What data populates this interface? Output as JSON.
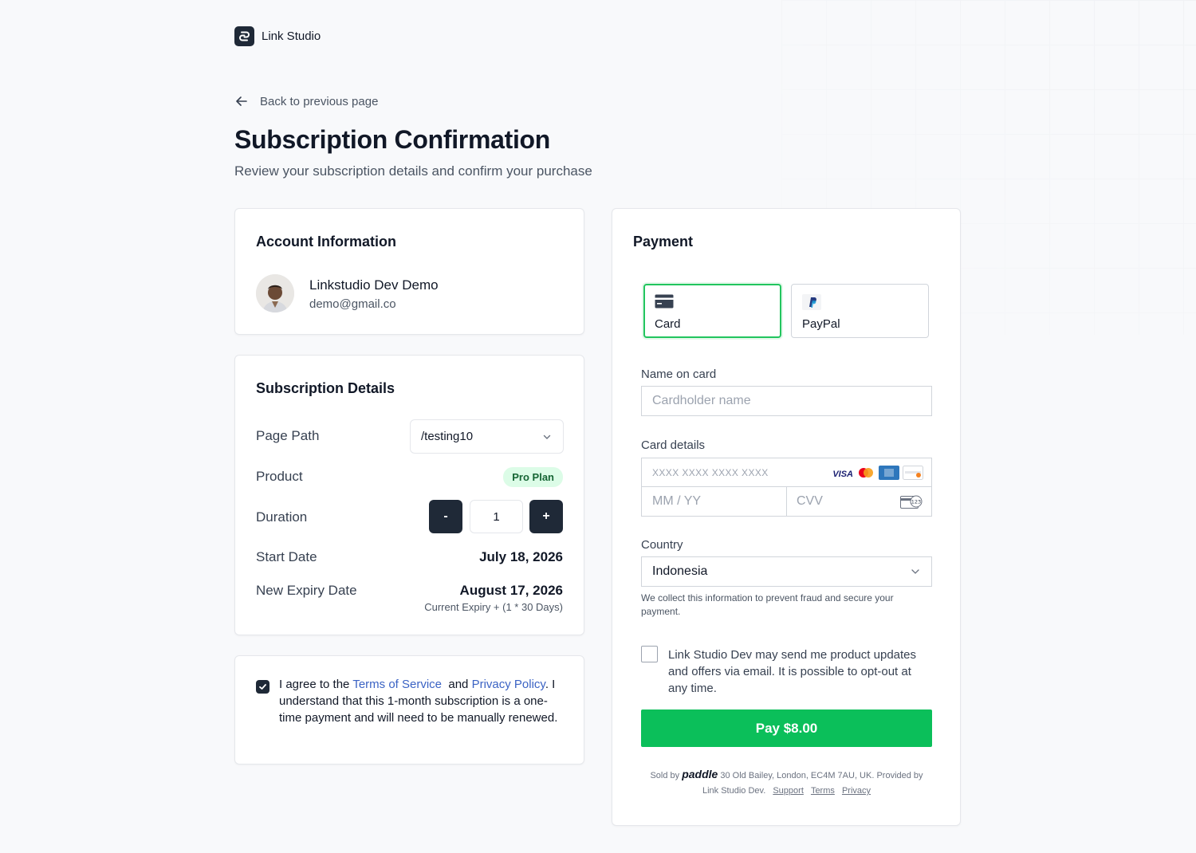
{
  "brand": {
    "name": "Link Studio"
  },
  "nav": {
    "back_label": "Back to previous page"
  },
  "page": {
    "title": "Subscription Confirmation",
    "subtitle": "Review your subscription details and confirm your purchase"
  },
  "account": {
    "title": "Account Information",
    "name": "Linkstudio Dev Demo",
    "email": "demo@gmail.co"
  },
  "subscription": {
    "title": "Subscription Details",
    "page_path_label": "Page Path",
    "page_path_value": "/testing10",
    "product_label": "Product",
    "product_badge": "Pro Plan",
    "duration_label": "Duration",
    "duration_minus": "-",
    "duration_value": "1",
    "duration_plus": "+",
    "start_date_label": "Start Date",
    "start_date_value": "July 18, 2026",
    "expiry_label": "New Expiry Date",
    "expiry_value": "August 17, 2026",
    "expiry_note": "Current Expiry + (1 * 30 Days)"
  },
  "agreement": {
    "prefix": "I agree to the",
    "terms_link": "Terms of Service",
    "and": "and",
    "privacy_link": "Privacy Policy",
    "suffix": ". I understand that this 1-month subscription is a one-time payment and will need to be manually renewed.",
    "checked": true
  },
  "payment": {
    "title": "Payment",
    "methods": [
      {
        "label": "Card",
        "icon": "credit-card-icon",
        "selected": true
      },
      {
        "label": "PayPal",
        "icon": "paypal-icon",
        "selected": false
      }
    ],
    "name_label": "Name on card",
    "name_placeholder": "Cardholder name",
    "card_label": "Card details",
    "card_number_placeholder": "XXXX XXXX XXXX XXXX",
    "card_brands": [
      "VISA",
      "mastercard",
      "amex",
      "discover"
    ],
    "expiry_placeholder": "MM / YY",
    "cvv_placeholder": "CVV",
    "cvv_icon_text": "123",
    "country_label": "Country",
    "country_value": "Indonesia",
    "fraud_note": "We collect this information to prevent fraud and secure your payment.",
    "marketing_opt_in": "Link Studio Dev may send me product updates and offers via email. It is possible to opt-out at any time.",
    "pay_button": "Pay $8.00",
    "accent_color": "#0bbf5a"
  },
  "footer": {
    "sold_by": "Sold by",
    "paddle": "paddle",
    "address": "30 Old Bailey, London, EC4M 7AU, UK. Provided by Link Studio Dev.",
    "support": "Support",
    "terms": "Terms",
    "privacy": "Privacy"
  }
}
